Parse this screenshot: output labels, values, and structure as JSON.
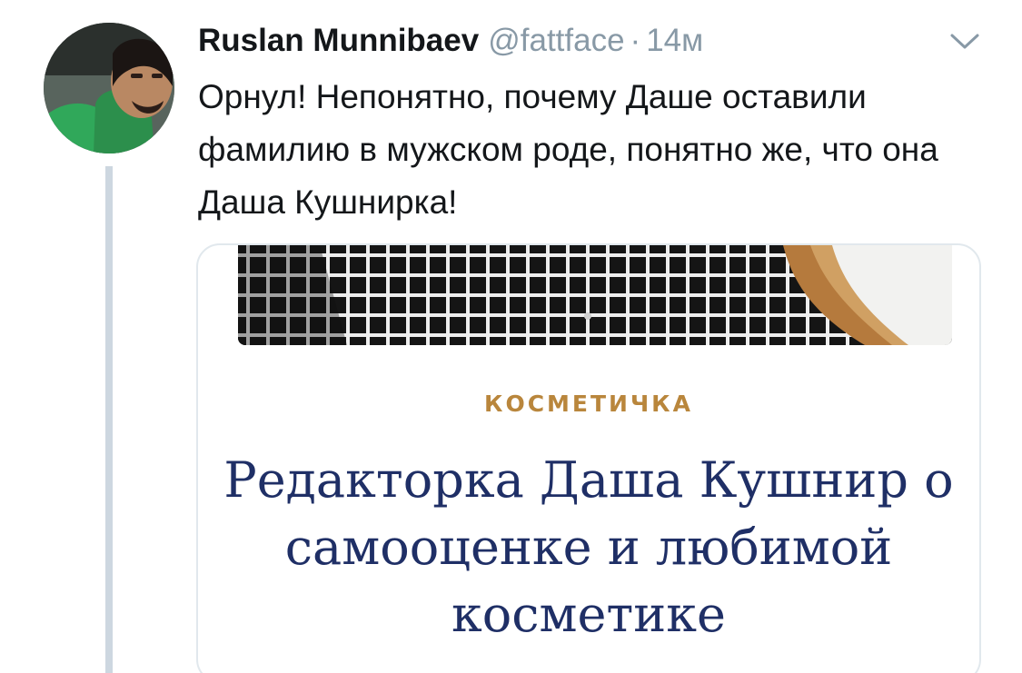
{
  "tweet": {
    "author_name": "Ruslan Munnibaev",
    "handle": "@fattface",
    "separator": "·",
    "time": "14м",
    "text": "Орнул! Непонятно, почему Даше оставили фамилию в мужском роде, понятно же, что она Даша Кушнирка!"
  },
  "icons": {
    "avatar": "user-avatar",
    "menu": "chevron-down-icon"
  },
  "card": {
    "category": "КОСМЕТИЧКА",
    "title": "Редакторка Даша Кушнир о самооценке и любимой косметике"
  },
  "colors": {
    "text": "#14171a",
    "secondary": "#8899a6",
    "thread_line": "#cdd7e0",
    "card_border": "#e1e8ed",
    "category": "#b9863c",
    "title": "#1f2f66"
  }
}
